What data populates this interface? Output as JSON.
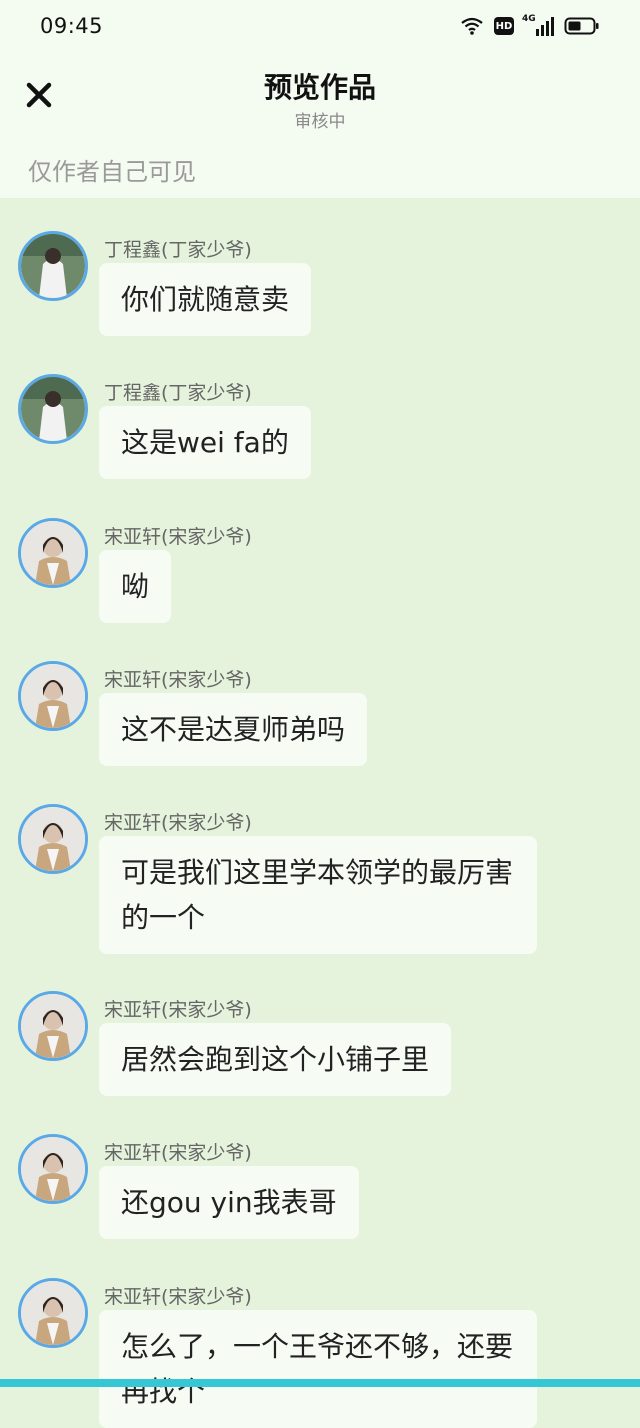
{
  "status_bar": {
    "time": "09:45",
    "hd_label": "HD",
    "network": "4G"
  },
  "header": {
    "title": "预览作品",
    "subtitle": "审核中",
    "visibility_note": "仅作者自己可见"
  },
  "messages": [
    {
      "sender": "丁程鑫(丁家少爷)",
      "text": "你们就随意卖",
      "avatar": "ding"
    },
    {
      "sender": "丁程鑫(丁家少爷)",
      "text": "这是wei fa的",
      "avatar": "ding"
    },
    {
      "sender": "宋亚轩(宋家少爷)",
      "text": "呦",
      "avatar": "song"
    },
    {
      "sender": "宋亚轩(宋家少爷)",
      "text": "这不是达夏师弟吗",
      "avatar": "song"
    },
    {
      "sender": "宋亚轩(宋家少爷)",
      "text": "可是我们这里学本领学的最厉害的一个",
      "avatar": "song"
    },
    {
      "sender": "宋亚轩(宋家少爷)",
      "text": "居然会跑到这个小铺子里",
      "avatar": "song"
    },
    {
      "sender": "宋亚轩(宋家少爷)",
      "text": "还gou yin我表哥",
      "avatar": "song"
    },
    {
      "sender": "宋亚轩(宋家少爷)",
      "text": "怎么了，一个王爷还不够，还要再找个",
      "avatar": "song"
    }
  ],
  "colors": {
    "background": "#e5f3dc",
    "bubble": "#f6fbf4",
    "avatar_ring": "#5aa9e6",
    "accent_strip": "#35c7d3"
  }
}
